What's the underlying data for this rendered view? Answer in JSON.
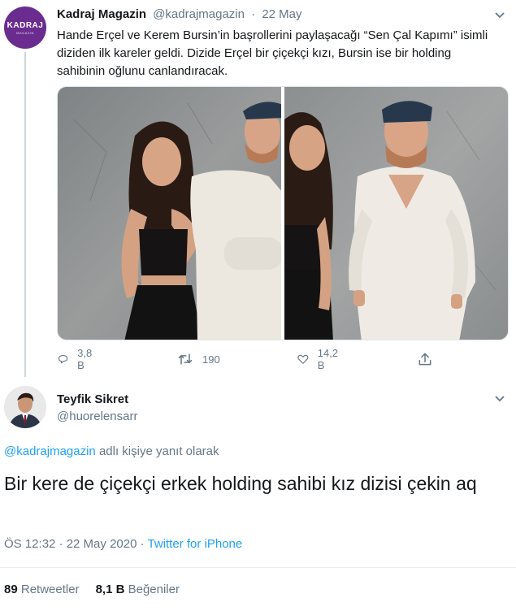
{
  "tweet1": {
    "avatar_logo": "KADRAJ",
    "avatar_logo_sub": "MAGAZIN",
    "name": "Kadraj Magazin",
    "handle": "@kadrajmagazin",
    "separator": "·",
    "date": "22 May",
    "text": "Hande Erçel ve Kerem Bursin’in başrollerini paylaşacağı “Sen Çal Kapımı” isimli diziden ilk kareler geldi. Dizide Erçel bir çiçekçi kızı, Bursin ise bir holding sahibinin oğlunu canlandıracak.",
    "replies": "3,8 B",
    "retweets": "190",
    "likes": "14,2 B",
    "icons": {
      "reply": "reply-icon",
      "retweet": "retweet-icon",
      "like": "heart-icon",
      "share": "share-icon",
      "menu": "chevron-down-icon"
    }
  },
  "tweet2": {
    "name": "Teyfik Sikret",
    "handle": "@huorelensarr",
    "reply_mention": "@kadrajmagazin",
    "reply_suffix": " adlı kişiye yanıt olarak",
    "text": "Bir kere de çiçekçi erkek holding sahibi kız dizisi çekin aq",
    "time": "ÖS 12:32 · 22 May 2020 ·",
    "source": "Twitter for iPhone",
    "retweets_count": "89",
    "retweets_label": "Retweetler",
    "likes_count": "8,1 B",
    "likes_label": "Beğeniler"
  },
  "colors": {
    "text": "#14171a",
    "secondary": "#657786",
    "accent": "#1da1f2",
    "brand": "#6b2c8f",
    "border": "#e6ecf0"
  }
}
